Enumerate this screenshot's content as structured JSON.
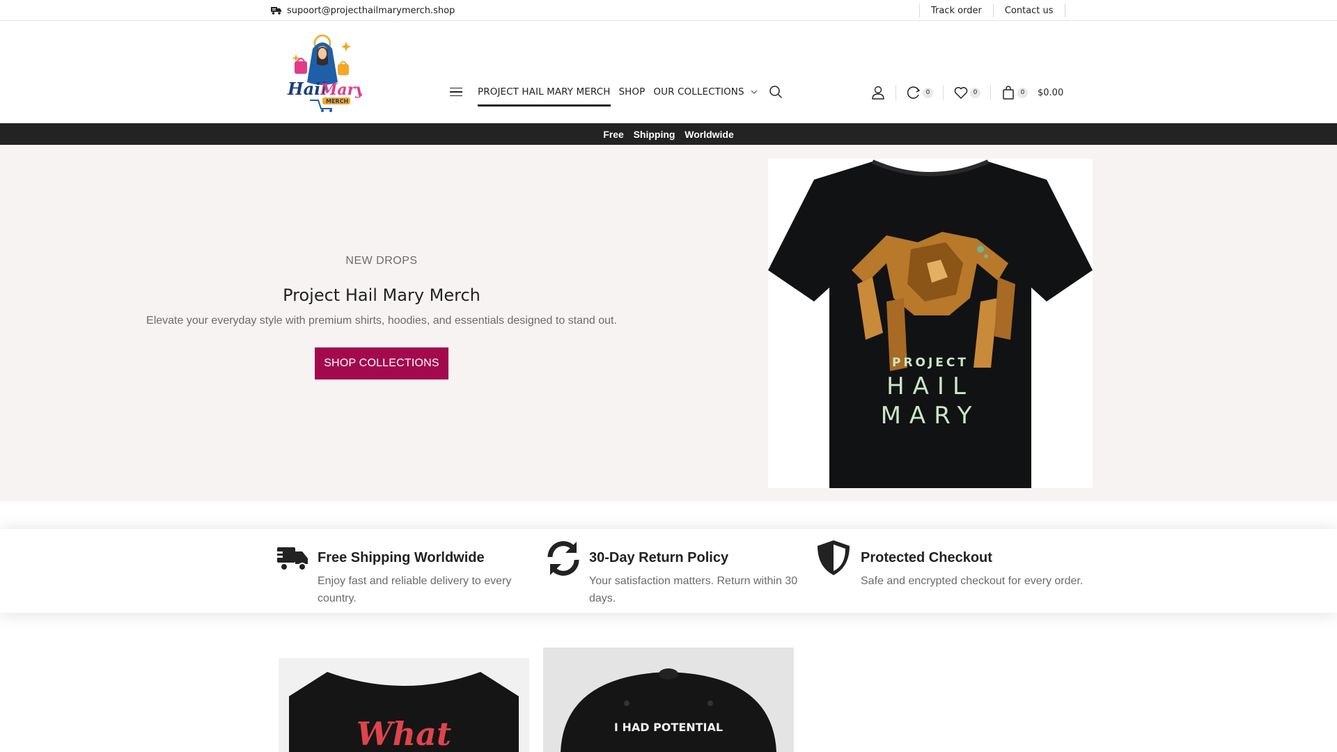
{
  "topbar": {
    "email": "supoort@projecthailmarymerch.shop",
    "links": [
      "Track order",
      "Contact us"
    ]
  },
  "header": {
    "logo_alt": "Hail Mary Merch",
    "logo_lines": [
      "Hail",
      "Mary",
      "MERCH"
    ],
    "nav": [
      {
        "label": "PROJECT HAIL MARY MERCH",
        "active": true
      },
      {
        "label": "SHOP"
      },
      {
        "label": "OUR COLLECTIONS",
        "has_dropdown": true
      }
    ],
    "compare_count": "0",
    "wishlist_count": "0",
    "cart_count": "0",
    "cart_total": "$0.00",
    "icons": [
      "menu-icon",
      "search-icon",
      "user-icon",
      "compare-icon",
      "heart-icon",
      "bag-icon"
    ]
  },
  "announcement": "Free  Shipping  Worldwide",
  "hero": {
    "eyebrow": "NEW DROPS",
    "title": "Project Hail Mary Merch",
    "subtitle": "Elevate your everyday style with premium shirts, hoodies, and essentials designed to stand out.",
    "cta": "SHOP COLLECTIONS",
    "image_text": [
      "PROJECT",
      "HAIL",
      "MARY"
    ]
  },
  "features": [
    {
      "icon": "truck-icon",
      "title": "Free Shipping Worldwide",
      "text": "Enjoy fast and reliable delivery to every country."
    },
    {
      "icon": "refresh-icon",
      "title": "30-Day Return Policy",
      "text": "Your satisfaction matters. Return within 30 days."
    },
    {
      "icon": "shield-icon",
      "title": "Protected Checkout",
      "text": "Safe and encrypted checkout for every order."
    }
  ],
  "products": [
    {
      "image_text": "What"
    },
    {
      "image_text": "I HAD POTENTIAL"
    }
  ],
  "colors": {
    "accent": "#a30a4e",
    "announcement_bg": "#232323",
    "hero_bg": "#f8f3f3"
  }
}
